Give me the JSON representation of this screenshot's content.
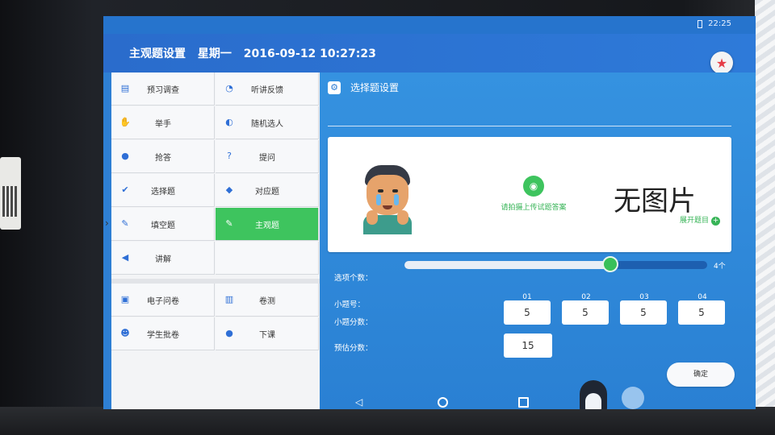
{
  "status_bar": {
    "time": "22:25"
  },
  "header": {
    "page_title": "主观题设置",
    "weekday": "星期一",
    "datetime": "2016-09-12 10:27:23"
  },
  "menu": {
    "items": [
      {
        "label": "预习调查",
        "icon": "survey-icon"
      },
      {
        "label": "听讲反馈",
        "icon": "chat-icon"
      },
      {
        "label": "举手",
        "icon": "hand-icon"
      },
      {
        "label": "随机选人",
        "icon": "random-icon"
      },
      {
        "label": "抢答",
        "icon": "bell-icon"
      },
      {
        "label": "提问",
        "icon": "question-icon"
      },
      {
        "label": "选择题",
        "icon": "check-icon"
      },
      {
        "label": "对应题",
        "icon": "cube-icon"
      },
      {
        "label": "填空题",
        "icon": "pencil-icon"
      },
      {
        "label": "主观题",
        "icon": "edit-icon"
      },
      {
        "label": "讲解",
        "icon": "megaphone-icon"
      },
      {
        "label": "",
        "icon": ""
      },
      {
        "label": "电子问卷",
        "icon": "document-icon"
      },
      {
        "label": "卷测",
        "icon": "book-icon"
      },
      {
        "label": "学生批卷",
        "icon": "user-icon"
      },
      {
        "label": "下课",
        "icon": "bell-icon"
      }
    ],
    "active": "主观题"
  },
  "content": {
    "section_title": "选择题设置",
    "upload_hint": "请拍摄上传试题答案",
    "no_image_text": "无图片",
    "expand_question": "展开题目",
    "option_count_label": "选项个数：",
    "option_count_value": "4个",
    "option_count_fraction": 0.68,
    "sub_question_label": "小题号：",
    "sub_score_label": "小题分数：",
    "sub_questions": [
      {
        "num": "01",
        "score": "5"
      },
      {
        "num": "02",
        "score": "5"
      },
      {
        "num": "03",
        "score": "5"
      },
      {
        "num": "04",
        "score": "5"
      }
    ],
    "estimate_label": "预估分数：",
    "estimate_value": "15",
    "confirm_label": "确定"
  },
  "colors": {
    "accent_blue": "#2e7fd4",
    "active_green": "#3ec45e",
    "fab_star": "#e53c46"
  }
}
